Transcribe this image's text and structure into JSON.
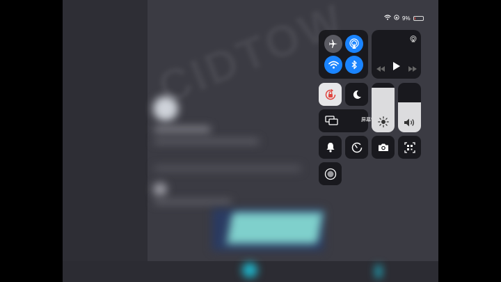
{
  "status_bar": {
    "battery_percent": "9%",
    "battery_level": 0.09,
    "icons": [
      "wifi-icon",
      "orientation-lock-icon",
      "battery-charging-icon"
    ]
  },
  "control_center": {
    "connectivity": {
      "airplane_mode": {
        "icon": "airplane-icon",
        "on": false
      },
      "airdrop": {
        "icon": "airdrop-icon",
        "on": true
      },
      "wifi": {
        "icon": "wifi-icon",
        "on": true
      },
      "bluetooth": {
        "icon": "bluetooth-icon",
        "on": true
      }
    },
    "media": {
      "icons": [
        "airplay-icon",
        "rewind-icon",
        "play-icon",
        "fast-forward-icon"
      ]
    },
    "orientation_lock": {
      "icon": "orientation-lock-icon",
      "on": true
    },
    "do_not_disturb": {
      "icon": "moon-icon",
      "on": false
    },
    "screen_mirroring": {
      "label": "屏幕镜像",
      "icon": "screen-mirroring-icon"
    },
    "brightness": {
      "icon": "sun-icon",
      "level": 0.9
    },
    "volume": {
      "icon": "speaker-icon",
      "level": 0.6
    },
    "shortcuts": [
      {
        "name": "bell",
        "icon": "bell-icon"
      },
      {
        "name": "timer",
        "icon": "timer-icon"
      },
      {
        "name": "camera",
        "icon": "camera-icon"
      },
      {
        "name": "qr-scanner",
        "icon": "qr-code-icon"
      },
      {
        "name": "screen-recording",
        "icon": "record-icon"
      }
    ],
    "colors": {
      "accent": "#1a84ff",
      "tile": "#121216",
      "orientation_lock_red": "#e0443e"
    }
  }
}
